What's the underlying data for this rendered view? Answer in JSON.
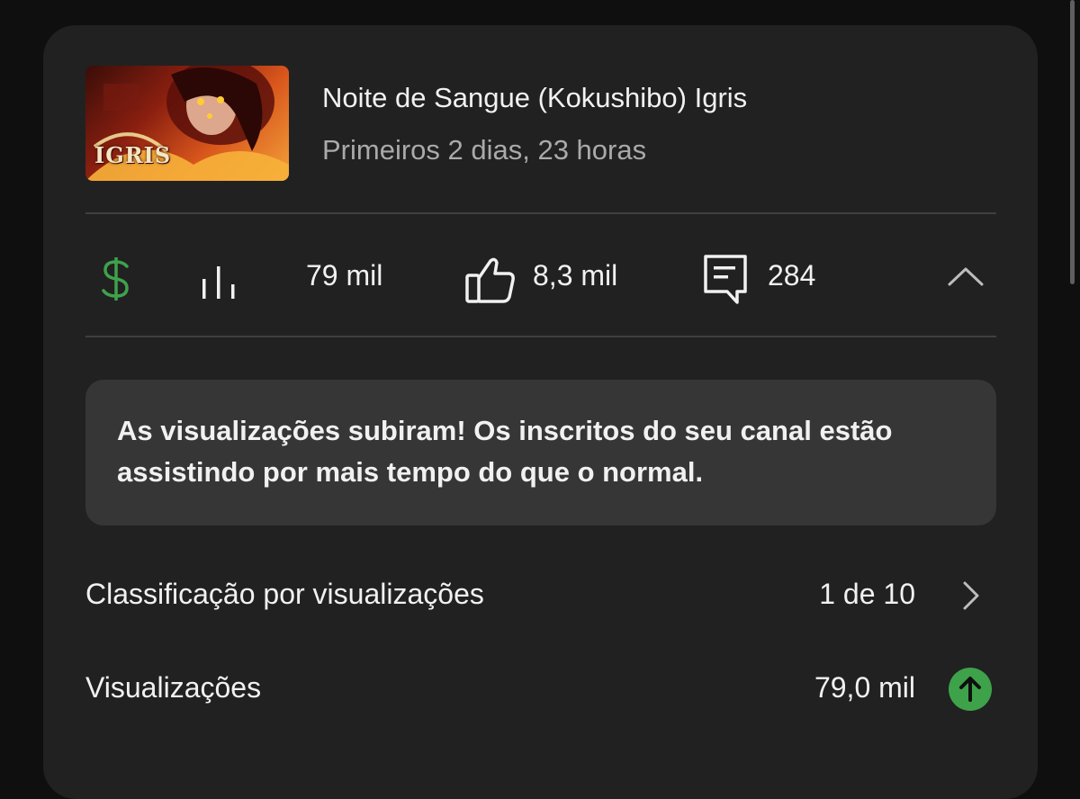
{
  "video": {
    "title": "Noite de Sangue (Kokushibo) Igris",
    "period": "Primeiros 2 dias, 23 horas",
    "thumbnail_text": "IGRIS"
  },
  "stats": {
    "views": "79 mil",
    "likes": "8,3 mil",
    "comments": "284",
    "icons": [
      "dollar-icon",
      "bar-chart-icon",
      "thumbs-up-icon",
      "comment-icon",
      "chevron-up-icon"
    ],
    "monetization_color": "#3ea24a"
  },
  "insight": {
    "text": "As visualizações subiram! Os inscritos do seu canal estão assistindo por mais tempo do que o normal."
  },
  "rows": [
    {
      "label": "Classificação por visualizações",
      "value": "1 de 10",
      "icon": "chevron-right-icon"
    },
    {
      "label": "Visualizações",
      "value": "79,0 mil",
      "icon": "arrow-up-circle-icon",
      "icon_color": "#3ea24a"
    }
  ]
}
